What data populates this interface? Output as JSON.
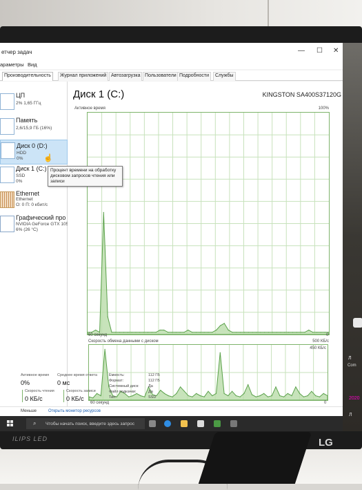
{
  "app": {
    "title": "етчер задач",
    "menu": [
      "араметры",
      "Вид"
    ],
    "tabs": [
      "Производительность",
      "Журнал приложений",
      "Автозагрузка",
      "Пользователи",
      "Подробности",
      "Службы"
    ],
    "active_tab": 0
  },
  "window_controls": {
    "minimize": "—",
    "maximize": "☐",
    "close": "✕"
  },
  "sidebar": {
    "items": [
      {
        "title": "ЦП",
        "sub1": "2% 1,65 ГГц",
        "sub2": ""
      },
      {
        "title": "Память",
        "sub1": "2,6/15,9 ГБ (16%)",
        "sub2": ""
      },
      {
        "title": "Диск 0 (D:)",
        "sub1": "HDD",
        "sub2": "0%"
      },
      {
        "title": "Диск 1 (C:)",
        "sub1": "SSD",
        "sub2": "0%"
      },
      {
        "title": "Ethernet",
        "sub1": "Ethernet",
        "sub2": "О: 0 П: 0 кбит/с"
      },
      {
        "title": "Графический про",
        "sub1": "NVIDIA GeForce GTX 105",
        "sub2": "6% (26 °C)"
      }
    ],
    "selected_index": 2
  },
  "tooltip": {
    "text": "Процент времени на обработку дисковом запросов чтения или записи"
  },
  "main": {
    "title": "Диск 1 (C:)",
    "model": "KINGSTON SA400S37120G",
    "chart1": {
      "label": "Активное время",
      "max_label": "100%",
      "time_label": "60 секунд",
      "min_label": "0"
    },
    "chart2": {
      "label": "Скорость обмена данными с диском",
      "max_label": "500 КБ/с",
      "mid_label": "450 КБ/с",
      "time_label": "60 секунд",
      "min_label": "0"
    }
  },
  "stats": {
    "active_time_label": "Активное время",
    "active_time_value": "0%",
    "avg_response_label": "Среднее время ответа",
    "avg_response_value": "0 мс",
    "read_speed_label": "Скорость чтения",
    "read_speed_value": "0 КБ/с",
    "write_speed_label": "Скорость записи",
    "write_speed_value": "0 КБ/с",
    "capacity_label": "Емкость:",
    "capacity_value": "112 ГБ",
    "formatted_label": "Формат:",
    "formatted_value": "112 ГБ",
    "system_disk_label": "Системный диск:",
    "system_disk_value": "Да",
    "pagefile_label": "Файл подкачки:",
    "pagefile_value": "Да",
    "type_label": "Тип:",
    "type_value": "SSD"
  },
  "footer": {
    "less": "Меньше",
    "monitor": "Открыть монитор ресурсов"
  },
  "taskbar": {
    "search_placeholder": "Чтобы начать поиск, введите здесь запрос"
  },
  "monitor": {
    "brand_left": "ILIPS LED",
    "brand_right": "LG"
  },
  "desk_right": {
    "t1": "Л",
    "t2": "Соm",
    "t3": "2020",
    "t4": "Л"
  },
  "chart_data": [
    {
      "type": "area",
      "title": "Активное время",
      "xlabel": "60 секунд",
      "ylim": [
        0,
        100
      ],
      "x": [
        0,
        1,
        2,
        3,
        4,
        5,
        6,
        7,
        8,
        9,
        10,
        11,
        12,
        13,
        14,
        15,
        16,
        17,
        18,
        19,
        20,
        21,
        22,
        23,
        24,
        25,
        26,
        27,
        28,
        29,
        30,
        31,
        32,
        33,
        34,
        35,
        36,
        37,
        38,
        39,
        40,
        41,
        42,
        43,
        44,
        45,
        46,
        47,
        48,
        49,
        50,
        51,
        52,
        53,
        54,
        55,
        56,
        57,
        58,
        59,
        60
      ],
      "series": [
        {
          "values": [
            1,
            1,
            2,
            1,
            55,
            8,
            1,
            1,
            1,
            1,
            1,
            1,
            1,
            1,
            1,
            1,
            1,
            1,
            2,
            2,
            1,
            1,
            1,
            1,
            1,
            2,
            1,
            1,
            1,
            1,
            1,
            1,
            2,
            4,
            5,
            2,
            1,
            1,
            1,
            1,
            1,
            1,
            1,
            1,
            1,
            1,
            1,
            1,
            1,
            1,
            1,
            1,
            1,
            1,
            1,
            2,
            1,
            1,
            1,
            1,
            1
          ]
        }
      ]
    },
    {
      "type": "area",
      "title": "Скорость обмена данными с диском",
      "xlabel": "60 секунд",
      "ylim": [
        0,
        500
      ],
      "x": [
        0,
        1,
        2,
        3,
        4,
        5,
        6,
        7,
        8,
        9,
        10,
        11,
        12,
        13,
        14,
        15,
        16,
        17,
        18,
        19,
        20,
        21,
        22,
        23,
        24,
        25,
        26,
        27,
        28,
        29,
        30,
        31,
        32,
        33,
        34,
        35,
        36,
        37,
        38,
        39,
        40,
        41,
        42,
        43,
        44,
        45,
        46,
        47,
        48,
        49,
        50,
        51,
        52,
        53,
        54,
        55,
        56,
        57,
        58,
        59,
        60
      ],
      "series": [
        {
          "name": "Скорость чтения",
          "values": [
            30,
            20,
            60,
            40,
            460,
            120,
            40,
            30,
            80,
            60,
            30,
            40,
            60,
            40,
            30,
            120,
            50,
            40,
            90,
            60,
            40,
            30,
            60,
            120,
            80,
            40,
            30,
            60,
            40,
            30,
            80,
            40,
            60,
            430,
            60,
            40,
            80,
            40,
            30,
            60,
            140,
            50,
            30,
            40,
            60,
            30,
            40,
            120,
            40,
            30,
            60,
            40,
            120,
            60,
            30,
            40,
            80,
            40,
            30,
            60,
            40
          ]
        }
      ]
    }
  ]
}
